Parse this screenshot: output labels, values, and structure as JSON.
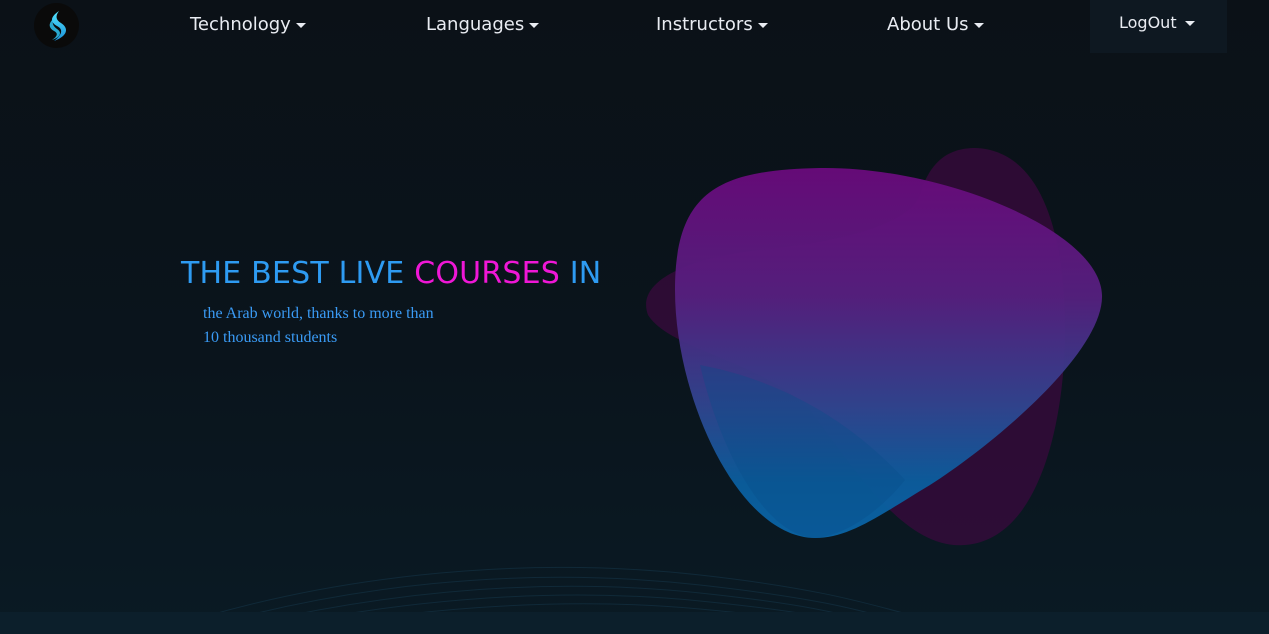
{
  "nav": {
    "items": [
      {
        "label": "Technology"
      },
      {
        "label": "Languages"
      },
      {
        "label": "Instructors"
      },
      {
        "label": "About Us"
      }
    ],
    "logout_label": "LogOut"
  },
  "hero": {
    "title_part1": "THE BEST LIVE ",
    "title_highlight": "COURSES",
    "title_part2": " IN",
    "subtitle_line1": "the Arab world, thanks to more than",
    "subtitle_line2": "10 thousand students"
  },
  "colors": {
    "background": "#0b1117",
    "title_blue": "#2e9bf2",
    "title_pink": "#ef17d6",
    "subtitle": "#3a9bf5",
    "blob_purple": "#6a0a7c",
    "blob_blue": "#0a64a6"
  },
  "icons": {
    "logo": "flame-logo-icon",
    "dropdown": "caret-down-icon"
  }
}
